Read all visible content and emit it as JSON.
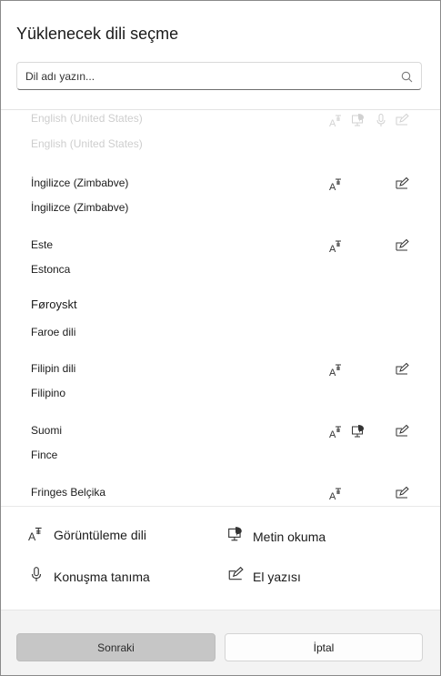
{
  "dialog": {
    "title": "Yüklenecek dili seçme",
    "search_placeholder": "Dil adı yazın..."
  },
  "languages": [
    {
      "name": "English (United States)",
      "local": "English (United States)",
      "features": [
        "display",
        "speech_recognition_tts",
        "speech",
        "handwriting"
      ],
      "faded": true
    },
    {
      "name": "İngilizce (Zimbabve)",
      "local": "İngilizce (Zimbabve)",
      "features": [
        "display",
        "handwriting"
      ]
    },
    {
      "name": "Este",
      "local": "Estonca",
      "features": [
        "display",
        "handwriting"
      ]
    },
    {
      "name": "Føroyskt",
      "local": "Faroe dili",
      "features": []
    },
    {
      "name": "Filipin dili",
      "local": "Filipino",
      "features": [
        "display",
        "handwriting"
      ]
    },
    {
      "name": "Suomi",
      "local": "Fince",
      "features": [
        "display",
        "tts",
        "handwriting"
      ]
    },
    {
      "name": "Fringes Belçika",
      "local": "",
      "features": [
        "display",
        "handwriting"
      ]
    }
  ],
  "legend": {
    "display_language": "Görüntüleme dili",
    "text_to_speech": "Metin okuma",
    "speech_recognition": "Konuşma tanıma",
    "handwriting": "El yazısı"
  },
  "footer": {
    "next_label": "Sonraki",
    "cancel_label": "İptal"
  },
  "icons": [
    "search-icon",
    "display-language-icon",
    "text-to-speech-icon",
    "microphone-icon",
    "handwriting-icon"
  ]
}
